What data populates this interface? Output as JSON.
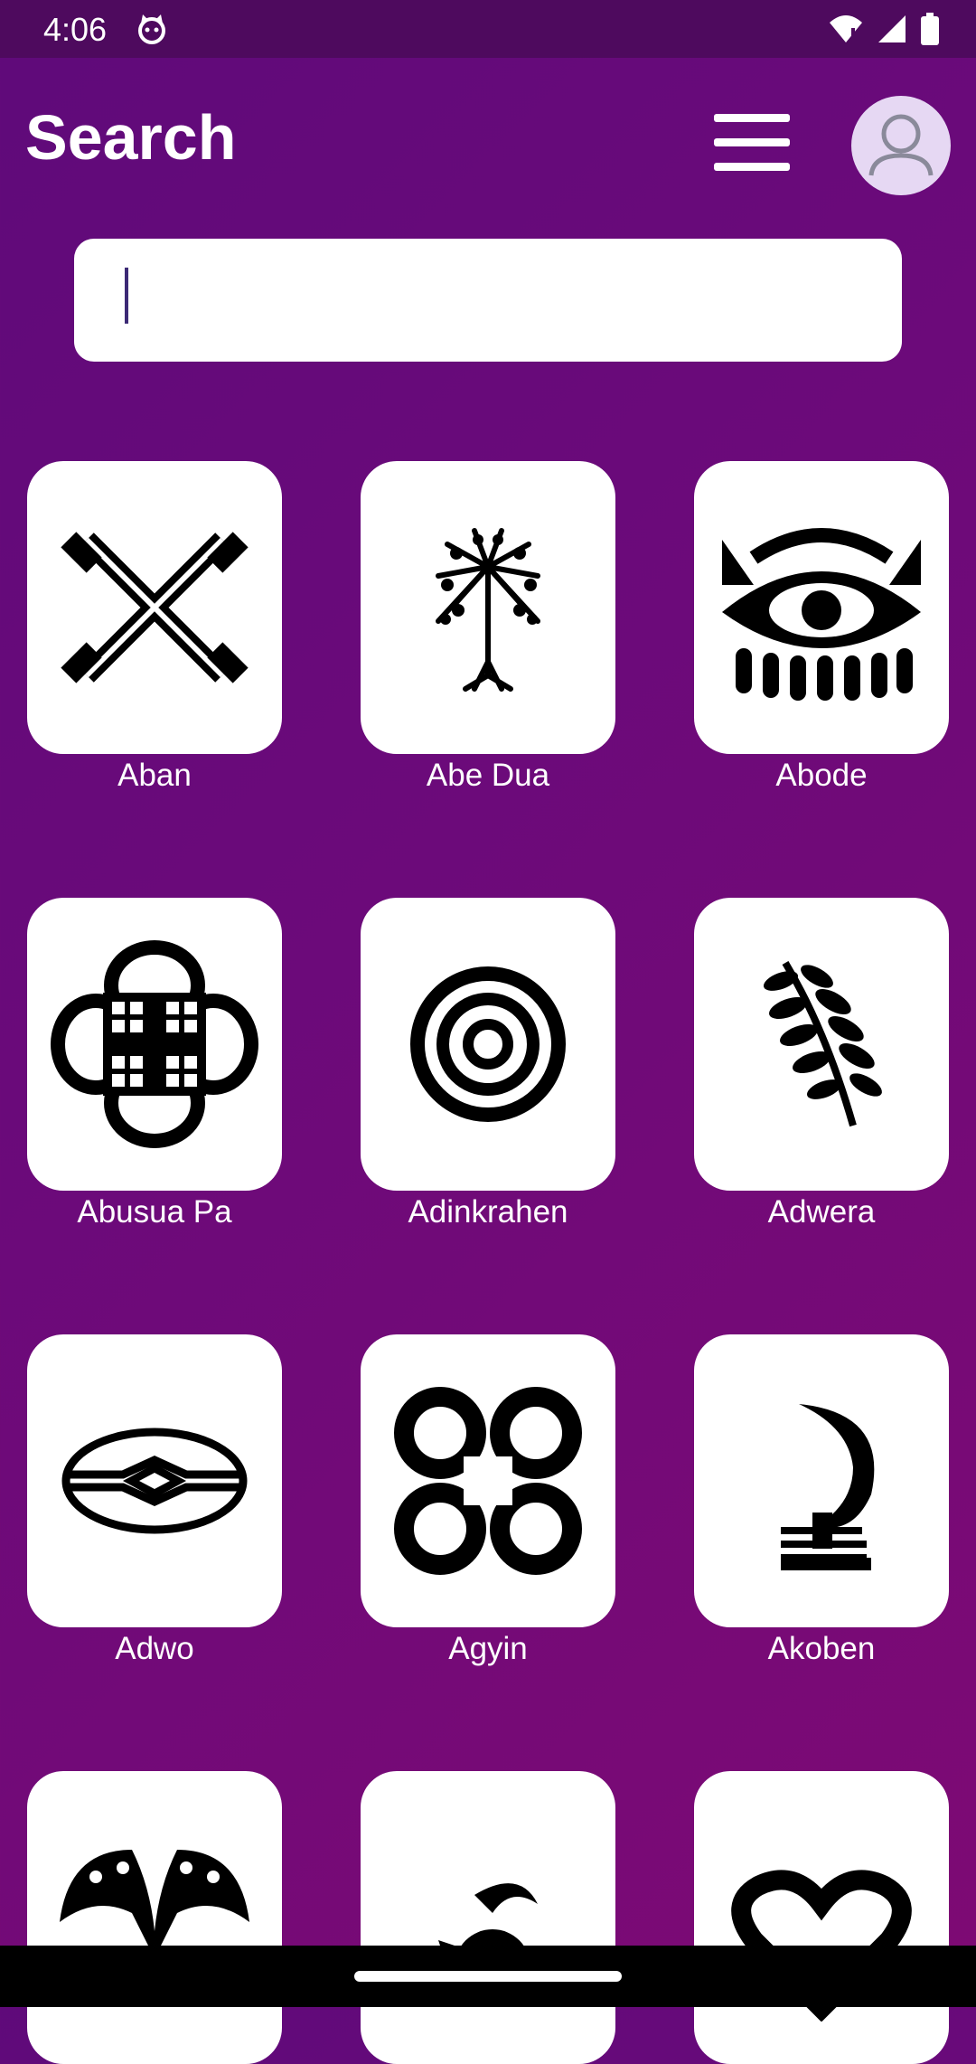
{
  "status_bar": {
    "time": "4:06"
  },
  "header": {
    "title": "Search"
  },
  "search": {
    "value": "",
    "placeholder": ""
  },
  "symbols": [
    {
      "label": "Aban",
      "icon": "aban-cross-icon"
    },
    {
      "label": "Abe Dua",
      "icon": "palm-tree-icon"
    },
    {
      "label": "Abode",
      "icon": "eye-icon"
    },
    {
      "label": "Abusua Pa",
      "icon": "abusua-pa-icon"
    },
    {
      "label": "Adinkrahen",
      "icon": "concentric-circles-icon"
    },
    {
      "label": "Adwera",
      "icon": "fern-leaf-icon"
    },
    {
      "label": "Adwo",
      "icon": "adwo-ellipse-icon"
    },
    {
      "label": "Agyin",
      "icon": "agyin-quatrefoil-icon"
    },
    {
      "label": "Akoben",
      "icon": "horn-icon"
    },
    {
      "label": "",
      "icon": "akokonan-icon"
    },
    {
      "label": "",
      "icon": "akoma-ntoso-icon"
    },
    {
      "label": "",
      "icon": "heart-icon"
    }
  ]
}
